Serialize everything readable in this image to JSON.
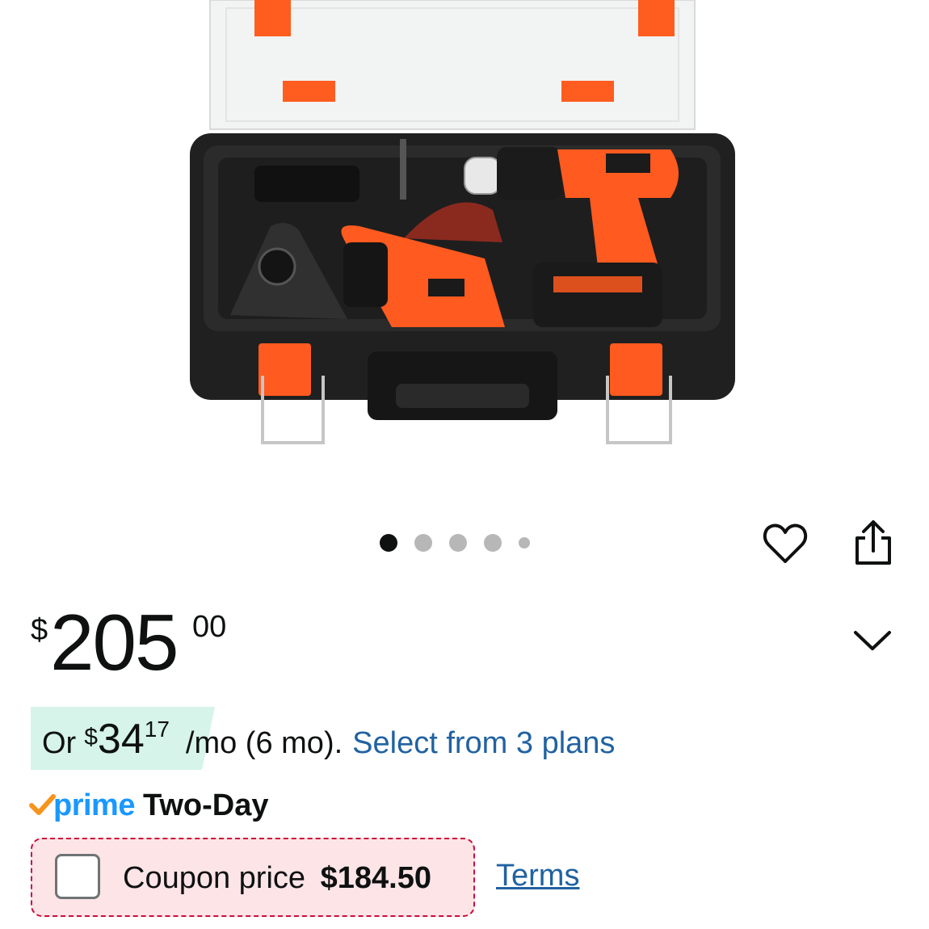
{
  "carousel": {
    "image_alt": "BLACK+DECKER drill kit in carrying case",
    "dot_count": 5,
    "active_index": 0
  },
  "actions": {
    "favorite_icon": "heart-icon",
    "share_icon": "share-icon"
  },
  "price": {
    "symbol": "$",
    "whole": "205",
    "fraction": "00"
  },
  "expand_icon": "chevron-down-icon",
  "installment": {
    "prefix": "Or",
    "currency": "$",
    "amount": "34",
    "cents": "17",
    "suffix": "/mo (6 mo).",
    "link": "Select from 3 plans"
  },
  "delivery": {
    "prime_word": "prime",
    "label": "Two-Day"
  },
  "coupon": {
    "label": "Coupon price",
    "value": "$184.50",
    "terms": "Terms"
  },
  "colors": {
    "link": "#2162a1",
    "prime": "#1a98ff",
    "coupon_border": "#cc0c39",
    "installment_bg": "#d6f4ea"
  }
}
